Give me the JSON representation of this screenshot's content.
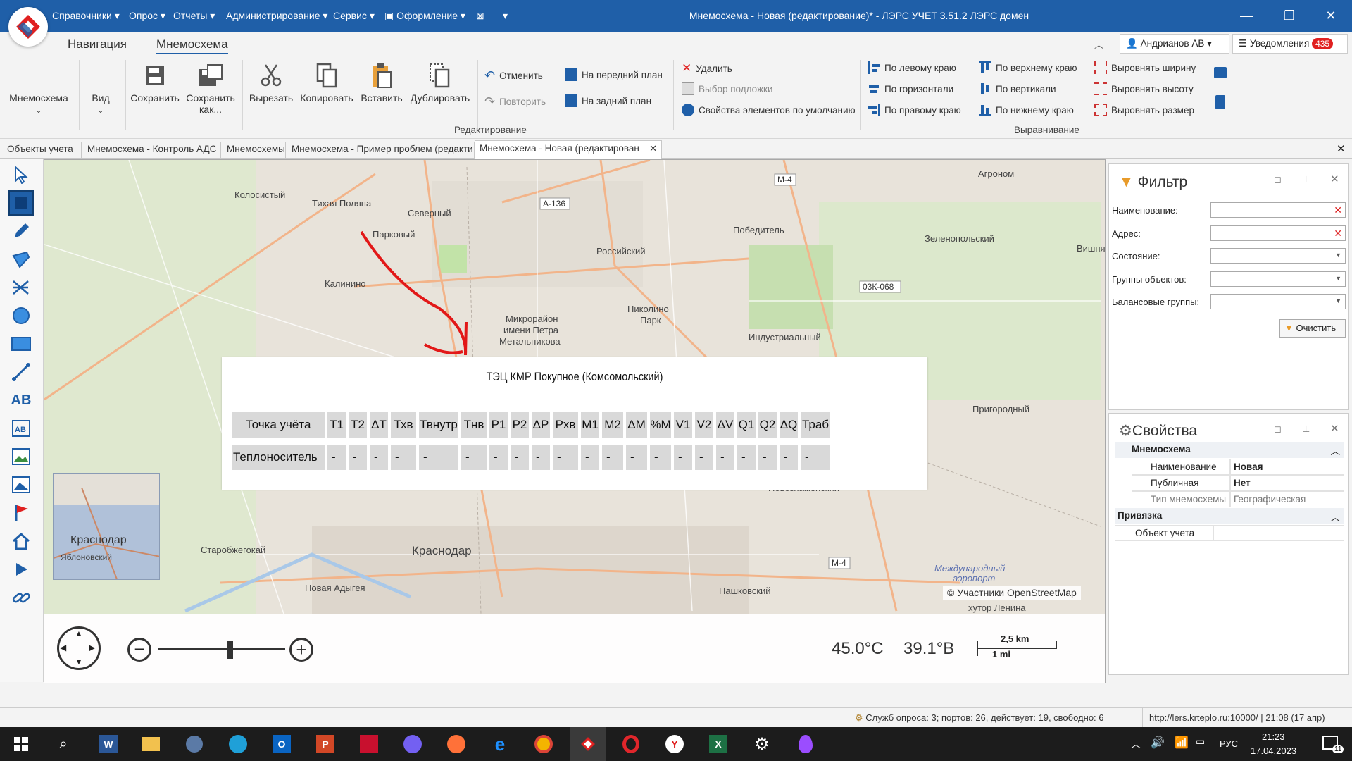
{
  "title_menu": {
    "items": [
      "Справочники",
      "Опрос",
      "Отчеты",
      "Администрирование",
      "Сервис",
      "Оформление"
    ],
    "window_title": "Мнемосхема - Новая (редактирование)* - ЛЭРС УЧЕТ 3.51.2 ЛЭРС домен"
  },
  "ribbon_tabs": {
    "nav": "Навигация",
    "mnemo": "Мнемосхема"
  },
  "user": {
    "name": "Андрианов АВ",
    "notifications_label": "Уведомления",
    "notifications_count": "435"
  },
  "ribbon": {
    "mnemo_label": "Мнемосхема",
    "view_label": "Вид",
    "save": "Сохранить",
    "save_as": "Сохранить как...",
    "cut": "Вырезать",
    "copy": "Копировать",
    "paste": "Вставить",
    "duplicate": "Дублировать",
    "undo": "Отменить",
    "redo": "Повторить",
    "front": "На передний план",
    "back": "На задний план",
    "delete": "Удалить",
    "background": "Выбор подложки",
    "default_props": "Свойства элементов по умолчанию",
    "edit_group": "Редактирование",
    "align_left": "По левому краю",
    "align_hcenter": "По горизонтали",
    "align_right": "По правому краю",
    "align_top": "По верхнему краю",
    "align_vcenter": "По вертикали",
    "align_bottom": "По нижнему краю",
    "eq_width": "Выровнять ширину",
    "eq_height": "Выровнять высоту",
    "eq_size": "Выровнять размер",
    "align_group": "Выравнивание"
  },
  "doc_tabs": [
    "Объекты учета",
    "Мнемосхема - Контроль АДС",
    "Мнемосхемы",
    "Мнемосхема - Пример проблем (редакти",
    "Мнемосхема - Новая (редактирован"
  ],
  "map": {
    "labels": [
      "Колосистый",
      "Тихая Поляна",
      "Северный",
      "Парковый",
      "Калинино",
      "Микрорайон имени Петра Метальникова",
      "Российский",
      "Победитель",
      "Зеленопольский",
      "Вишняки",
      "Николино Парк",
      "Индустриальный",
      "Пригородный",
      "Агроном",
      "Краснодар",
      "Старобжегокай",
      "Новая Адыгея",
      "Пашковский",
      "Международный аэропорт",
      "Новознаменский",
      "хутор Ленина",
      "Яблоновский"
    ],
    "road_labels": [
      "А-136",
      "М-4",
      "03К-068",
      "М-4"
    ],
    "minimap_label": "Краснодар",
    "attribution": "© Участники OpenStreetMap",
    "coord_x": "45.0°C",
    "coord_y": "39.1°В",
    "scale_km": "2,5 km",
    "scale_mi": "1 mi"
  },
  "mnemo": {
    "title": "ТЭЦ КМР Покупное (Комсомольский)",
    "headers": [
      "Точка учёта",
      "T1",
      "T2",
      "ΔT",
      "Тхв",
      "Твнутр",
      "Тнв",
      "P1",
      "P2",
      "ΔP",
      "Рхв",
      "M1",
      "M2",
      "ΔM",
      "%M",
      "V1",
      "V2",
      "ΔV",
      "Q1",
      "Q2",
      "ΔQ",
      "Траб"
    ],
    "row_label": "Теплоноситель",
    "row_values": [
      "-",
      "-",
      "-",
      "-",
      "-",
      "-",
      "-",
      "-",
      "-",
      "-",
      "-",
      "-",
      "-",
      "-",
      "-",
      "-",
      "-",
      "-",
      "-",
      "-",
      "-"
    ]
  },
  "filter": {
    "title": "Фильтр",
    "name_label": "Наименование:",
    "address_label": "Адрес:",
    "state_label": "Состояние:",
    "groups_label": "Группы объектов:",
    "balance_label": "Балансовые группы:",
    "clear": "Очистить"
  },
  "properties": {
    "title": "Свойства",
    "cat_mnemo": "Мнемосхема",
    "name_key": "Наименование",
    "name_val": "Новая",
    "public_key": "Публичная",
    "public_val": "Нет",
    "type_key": "Тип мнемосхемы",
    "type_val": "Географическая",
    "cat_binding": "Привязка",
    "object_key": "Объект учета",
    "object_val": ""
  },
  "status": {
    "left": "Служб опроса: 3; портов: 26, действует: 19, свободно: 6",
    "right": "http://lers.krteplo.ru:10000/ | 21:08 (17 апр)"
  },
  "taskbar": {
    "lang": "РУС",
    "time": "21:23",
    "date": "17.04.2023",
    "notif": "11"
  },
  "colors": {
    "accent": "#1f5fa8",
    "red": "#e02020"
  }
}
